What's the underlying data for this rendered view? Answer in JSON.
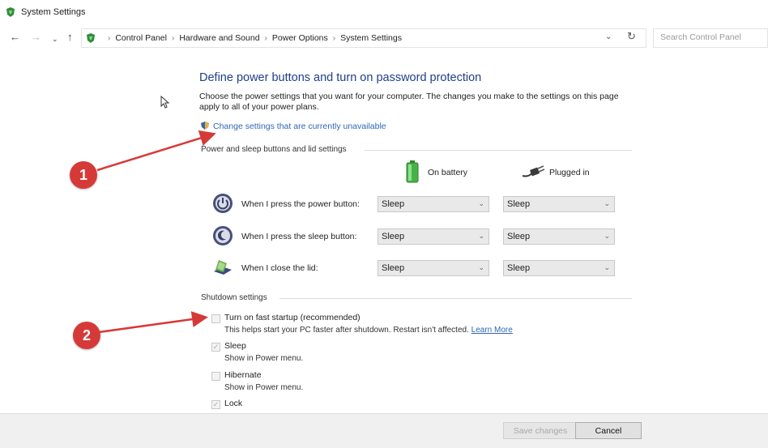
{
  "window": {
    "title": "System Settings"
  },
  "nav": {
    "back_icon": "back-arrow-icon",
    "forward_icon": "forward-arrow-icon",
    "recent_icon": "recent-locations-icon",
    "up_icon": "up-arrow-icon",
    "breadcrumbs": [
      "Control Panel",
      "Hardware and Sound",
      "Power Options",
      "System Settings"
    ],
    "search_placeholder": "Search Control Panel"
  },
  "main": {
    "heading": "Define power buttons and turn on password protection",
    "description": "Choose the power settings that you want for your computer. The changes you make to the settings on this page apply to all of your power plans.",
    "change_link": "Change settings that are currently unavailable"
  },
  "power_group": {
    "label": "Power and sleep buttons and lid settings",
    "col_battery": "On battery",
    "col_plugged": "Plugged in",
    "rows": [
      {
        "label": "When I press the power button:",
        "battery": "Sleep",
        "plugged": "Sleep",
        "icon": "power-button-icon"
      },
      {
        "label": "When I press the sleep button:",
        "battery": "Sleep",
        "plugged": "Sleep",
        "icon": "sleep-button-icon"
      },
      {
        "label": "When I close the lid:",
        "battery": "Sleep",
        "plugged": "Sleep",
        "icon": "laptop-lid-icon"
      }
    ]
  },
  "shutdown_group": {
    "label": "Shutdown settings",
    "options": [
      {
        "label": "Turn on fast startup (recommended)",
        "sub": "This helps start your PC faster after shutdown. Restart isn't affected.",
        "link": "Learn More",
        "checked": false
      },
      {
        "label": "Sleep",
        "sub": "Show in Power menu.",
        "checked": true
      },
      {
        "label": "Hibernate",
        "sub": "Show in Power menu.",
        "checked": false
      },
      {
        "label": "Lock",
        "checked": true
      }
    ]
  },
  "footer": {
    "save_label": "Save changes",
    "cancel_label": "Cancel"
  },
  "annotations": {
    "badge1": "1",
    "badge2": "2",
    "color": "#d63a38"
  }
}
